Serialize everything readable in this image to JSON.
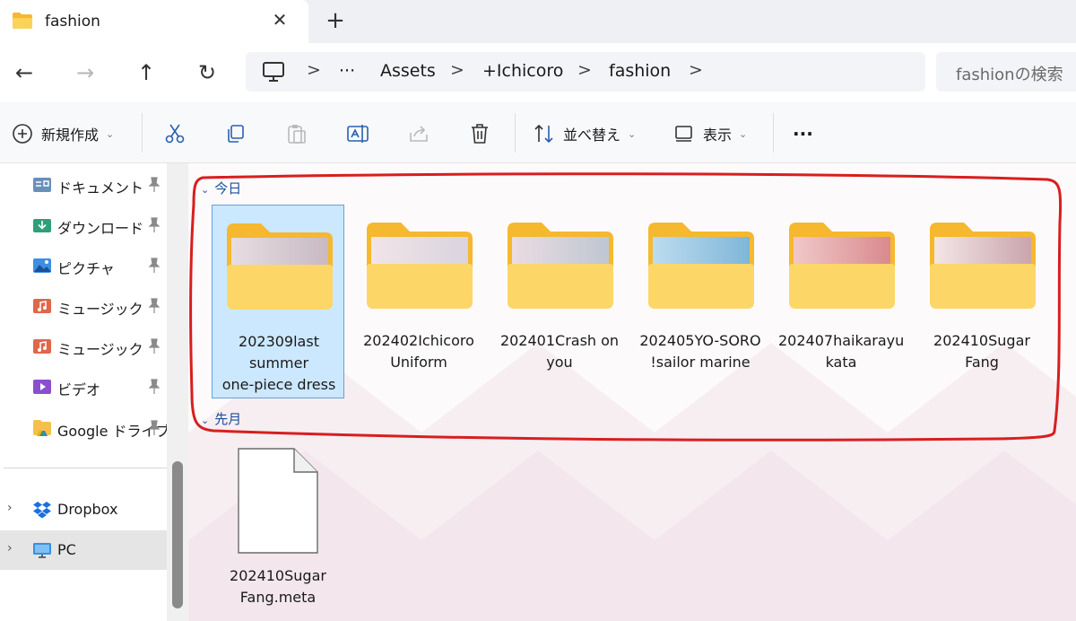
{
  "window": {
    "tab_title": "fashion",
    "tab_close": "✕",
    "new_tab": "+"
  },
  "nav": {
    "back": "←",
    "forward": "→",
    "up": "↑",
    "refresh": "↻",
    "breadcrumb_overflow": "···",
    "breadcrumbs": [
      "Assets",
      "+Ichicoro",
      "fashion"
    ],
    "separator": ">",
    "search_placeholder": "fashionの検索"
  },
  "commands": {
    "new": "新規作成",
    "sort": "並べ替え",
    "view": "表示",
    "more": "···"
  },
  "sidebar": {
    "pinned": [
      {
        "label": "ドキュメント",
        "icon": "documents-icon"
      },
      {
        "label": "ダウンロード",
        "icon": "downloads-icon"
      },
      {
        "label": "ピクチャ",
        "icon": "pictures-icon"
      },
      {
        "label": "ミュージック",
        "icon": "music-icon"
      },
      {
        "label": "ミュージック",
        "icon": "music-icon"
      },
      {
        "label": "ビデオ",
        "icon": "videos-icon"
      },
      {
        "label": "Google ドライブ",
        "icon": "google-drive-icon"
      }
    ],
    "locations": [
      {
        "label": "Dropbox",
        "icon": "dropbox-icon"
      },
      {
        "label": "PC",
        "icon": "pc-icon",
        "active": true
      }
    ]
  },
  "content": {
    "groups": [
      {
        "header": "今日",
        "items": [
          {
            "name": "202309last summer one-piece dress",
            "lines": [
              "202309last",
              "summer",
              "one-piece dress"
            ],
            "selected": true,
            "thumb": [
              "#e6dde2",
              "#c9b9c2"
            ]
          },
          {
            "name": "202402Ichicoro Uniform",
            "lines": [
              "202402Ichicoro",
              "Uniform"
            ],
            "selected": false,
            "thumb": [
              "#f1e4e8",
              "#d9d4de"
            ]
          },
          {
            "name": "202401Crash on you",
            "lines": [
              "202401Crash on",
              "you"
            ],
            "selected": false,
            "thumb": [
              "#eadce2",
              "#bfc6d2"
            ]
          },
          {
            "name": "202405YO-SORO!sailor marine",
            "lines": [
              "202405YO-SORO",
              "!sailor marine"
            ],
            "selected": false,
            "thumb": [
              "#bcdcef",
              "#7fb6d8"
            ]
          },
          {
            "name": "202407haikarayukata",
            "lines": [
              "202407haikarayu",
              "kata"
            ],
            "selected": false,
            "thumb": [
              "#f0c8c8",
              "#d98a8e"
            ]
          },
          {
            "name": "202410Sugar Fang",
            "lines": [
              "202410Sugar",
              "Fang"
            ],
            "selected": false,
            "thumb": [
              "#f3e5e6",
              "#c9a5ad"
            ]
          }
        ]
      },
      {
        "header": "先月",
        "items": [
          {
            "name": "202410Sugar Fang.meta",
            "lines": [
              "202410Sugar",
              "Fang.meta"
            ]
          }
        ]
      }
    ]
  },
  "colors": {
    "accent": "#1b4f9c",
    "selection": "#cce8ff",
    "folder": "#f9c440",
    "annotation": "#d81e1e"
  }
}
